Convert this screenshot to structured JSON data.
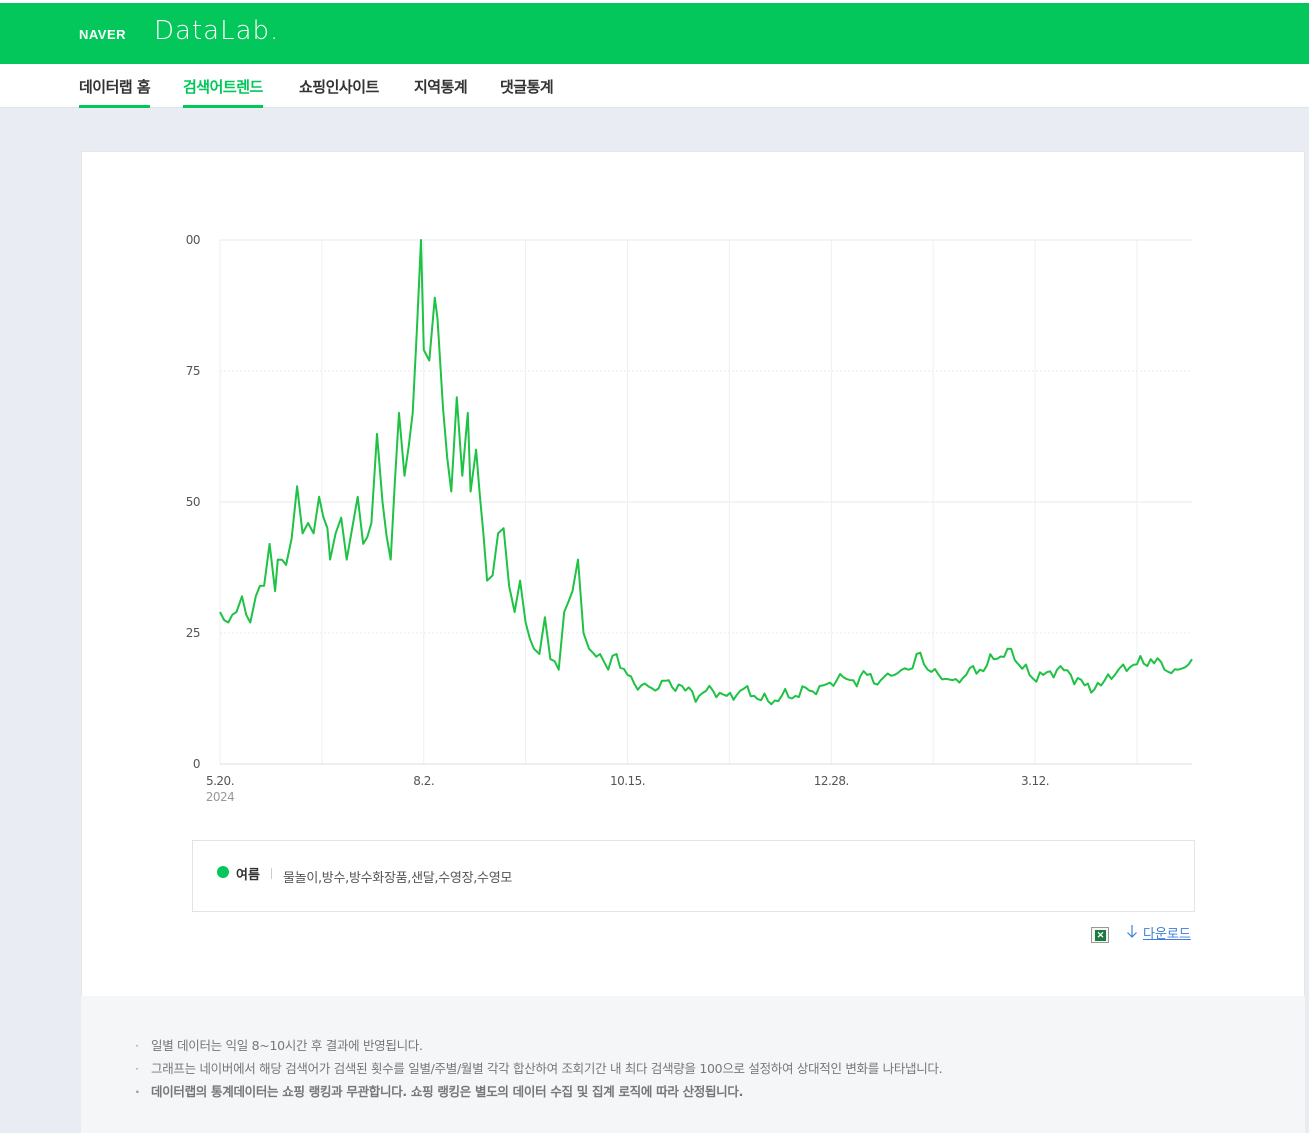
{
  "header": {
    "naver_logo": "NAVER",
    "datalab_logo": "DataLab."
  },
  "gnb": {
    "items": [
      {
        "label": "데이터랩 홈"
      },
      {
        "label": "검색어트렌드"
      },
      {
        "label": "쇼핑인사이트"
      },
      {
        "label": "지역통계"
      },
      {
        "label": "댓글통계"
      }
    ]
  },
  "legend": {
    "series_name": "여름",
    "keywords": "물놀이,방수,방수화장품,샌달,수영장,수영모"
  },
  "download": {
    "label": "다운로드",
    "excel_icon": "excel-icon",
    "arrow_icon": "download-arrow-icon"
  },
  "notice": {
    "items": [
      "일별 데이터는 익일 8~10시간 후 결과에 반영됩니다.",
      "그래프는 네이버에서 해당 검색어가 검색된 횟수를 일별/주별/월별 각각 합산하여 조회기간 내 최다 검색량을 100으로 설정하여 상대적인 변화를 나타냅니다.",
      "데이터랩의 통계데이터는 쇼핑 랭킹과 무관합니다. 쇼핑 랭킹은 별도의 데이터 수집 및 집계 로직에 따라 산정됩니다."
    ]
  },
  "colors": {
    "brand_green": "#03c75a",
    "line": "#1ec244"
  },
  "chart_data": {
    "type": "line",
    "x_start": "2024-05-20",
    "x_end": "2025-05-08",
    "x_tick_labels": [
      "5.20.",
      "8.2.",
      "10.15.",
      "12.28.",
      "3.12."
    ],
    "x_tick_dates": [
      "2024-05-20",
      "2024-08-02",
      "2024-10-15",
      "2024-12-28",
      "2025-03-12"
    ],
    "year_label": "2024",
    "y_tick_labels": [
      "0",
      "25",
      "50",
      "75",
      "00"
    ],
    "ylim": [
      0,
      100
    ],
    "grid": true,
    "series": [
      {
        "name": "여름",
        "anchors": [
          [
            "2024-05-20",
            29
          ],
          [
            "2024-05-23",
            27
          ],
          [
            "2024-05-26",
            29
          ],
          [
            "2024-05-28",
            32
          ],
          [
            "2024-05-31",
            27
          ],
          [
            "2024-06-02",
            32
          ],
          [
            "2024-06-05",
            34
          ],
          [
            "2024-06-07",
            42
          ],
          [
            "2024-06-09",
            33
          ],
          [
            "2024-06-10",
            39
          ],
          [
            "2024-06-13",
            38
          ],
          [
            "2024-06-15",
            43
          ],
          [
            "2024-06-17",
            53
          ],
          [
            "2024-06-19",
            44
          ],
          [
            "2024-06-21",
            46
          ],
          [
            "2024-06-23",
            44
          ],
          [
            "2024-06-25",
            51
          ],
          [
            "2024-06-28",
            45
          ],
          [
            "2024-06-29",
            39
          ],
          [
            "2024-07-01",
            44
          ],
          [
            "2024-07-03",
            47
          ],
          [
            "2024-07-05",
            39
          ],
          [
            "2024-07-07",
            45
          ],
          [
            "2024-07-09",
            51
          ],
          [
            "2024-07-11",
            42
          ],
          [
            "2024-07-14",
            46
          ],
          [
            "2024-07-16",
            63
          ],
          [
            "2024-07-18",
            50
          ],
          [
            "2024-07-21",
            39
          ],
          [
            "2024-07-24",
            67
          ],
          [
            "2024-07-26",
            55
          ],
          [
            "2024-07-29",
            67
          ],
          [
            "2024-08-01",
            100
          ],
          [
            "2024-08-02",
            79
          ],
          [
            "2024-08-04",
            77
          ],
          [
            "2024-08-06",
            89
          ],
          [
            "2024-08-07",
            85
          ],
          [
            "2024-08-09",
            68
          ],
          [
            "2024-08-12",
            52
          ],
          [
            "2024-08-14",
            70
          ],
          [
            "2024-08-16",
            55
          ],
          [
            "2024-08-18",
            67
          ],
          [
            "2024-08-19",
            52
          ],
          [
            "2024-08-21",
            60
          ],
          [
            "2024-08-25",
            35
          ],
          [
            "2024-08-27",
            36
          ],
          [
            "2024-08-29",
            44
          ],
          [
            "2024-08-31",
            45
          ],
          [
            "2024-09-02",
            34
          ],
          [
            "2024-09-04",
            29
          ],
          [
            "2024-09-06",
            35
          ],
          [
            "2024-09-08",
            27
          ],
          [
            "2024-09-11",
            22
          ],
          [
            "2024-09-13",
            21
          ],
          [
            "2024-09-15",
            28
          ],
          [
            "2024-09-17",
            20
          ],
          [
            "2024-09-20",
            18
          ],
          [
            "2024-09-22",
            29
          ],
          [
            "2024-09-25",
            33
          ],
          [
            "2024-09-27",
            39
          ],
          [
            "2024-09-29",
            25
          ],
          [
            "2024-10-01",
            22
          ],
          [
            "2024-10-05",
            21
          ],
          [
            "2024-10-08",
            18
          ],
          [
            "2024-10-11",
            21
          ],
          [
            "2024-10-15",
            17
          ],
          [
            "2024-10-20",
            15
          ],
          [
            "2024-10-25",
            14
          ],
          [
            "2024-10-30",
            16
          ],
          [
            "2024-11-05",
            14
          ],
          [
            "2024-11-10",
            13
          ],
          [
            "2024-11-15",
            14
          ],
          [
            "2024-11-20",
            13
          ],
          [
            "2024-11-25",
            14
          ],
          [
            "2024-11-30",
            13
          ],
          [
            "2024-12-05",
            12
          ],
          [
            "2024-12-10",
            13
          ],
          [
            "2024-12-15",
            13
          ],
          [
            "2024-12-20",
            14
          ],
          [
            "2024-12-25",
            15
          ],
          [
            "2024-12-30",
            16
          ],
          [
            "2025-01-05",
            16
          ],
          [
            "2025-01-10",
            17
          ],
          [
            "2025-01-15",
            16
          ],
          [
            "2025-01-20",
            17
          ],
          [
            "2025-01-25",
            18
          ],
          [
            "2025-01-28",
            21
          ],
          [
            "2025-02-01",
            18
          ],
          [
            "2025-02-05",
            17
          ],
          [
            "2025-02-10",
            16
          ],
          [
            "2025-02-15",
            17
          ],
          [
            "2025-02-20",
            18
          ],
          [
            "2025-02-25",
            20
          ],
          [
            "2025-03-02",
            22
          ],
          [
            "2025-03-06",
            19
          ],
          [
            "2025-03-10",
            17
          ],
          [
            "2025-03-15",
            17
          ],
          [
            "2025-03-20",
            18
          ],
          [
            "2025-03-25",
            17
          ],
          [
            "2025-03-30",
            15
          ],
          [
            "2025-04-05",
            15
          ],
          [
            "2025-04-10",
            17
          ],
          [
            "2025-04-13",
            19
          ],
          [
            "2025-04-18",
            19
          ],
          [
            "2025-04-23",
            20
          ],
          [
            "2025-04-28",
            18
          ],
          [
            "2025-05-03",
            18
          ],
          [
            "2025-05-08",
            20
          ]
        ]
      }
    ]
  }
}
